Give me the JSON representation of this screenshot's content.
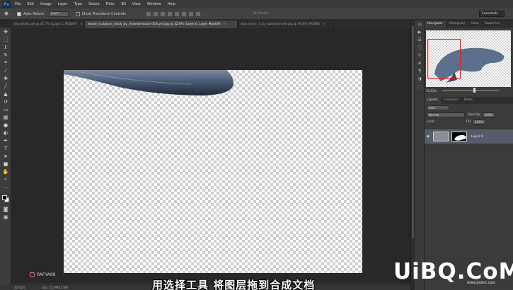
{
  "app": {
    "logo": "Ps",
    "menu": [
      "File",
      "Edit",
      "Image",
      "Layer",
      "Type",
      "Select",
      "Filter",
      "3D",
      "View",
      "Window",
      "Help"
    ]
  },
  "options": {
    "auto_select_label": "Auto-Select:",
    "auto_select_value": "Layer",
    "transform_label": "Show Transform Controls",
    "mode_3d": "3D Mode:",
    "workspace": "Essentials"
  },
  "tabs": [
    {
      "label": "big whale.psd @ 45.7% (Layer 5, RGB/8*)",
      "close": "×"
    },
    {
      "label": "whale_sculpture_stock_by_chamberstock-d53cyel.jpg @ 32.6% (Layer 0, Layer Mask/8)",
      "close": "×"
    },
    {
      "label": "blue_dress_1_by_stocknicholle.jpg @ 36.6% (RGB/8)",
      "close": "×"
    }
  ],
  "status": {
    "zoom": "32.61%",
    "doc": "Doc: 15.9M/15.9M"
  },
  "navigator": {
    "tabs": [
      "Navigator",
      "Histogram",
      "Color",
      "Swatches"
    ],
    "zoom": "32.61%"
  },
  "layers": {
    "tabs": [
      "Layers",
      "Channels",
      "Paths"
    ],
    "kind": "Kind",
    "blend": "Normal",
    "opacity_label": "Opacity:",
    "opacity_value": "100%",
    "lock_label": "Lock:",
    "fill_label": "Fill:",
    "fill_value": "100%",
    "layer_name": "Layer 0"
  },
  "overlay": {
    "watermark": "RAFYA88",
    "subtitle": "用选择工具  将图层拖到合成文档",
    "logo": "UiBQ.CoM",
    "logo_url": "www.psahz.com"
  },
  "colors": {
    "accent": "#e02020",
    "ps_blue": "#36a3ff"
  }
}
